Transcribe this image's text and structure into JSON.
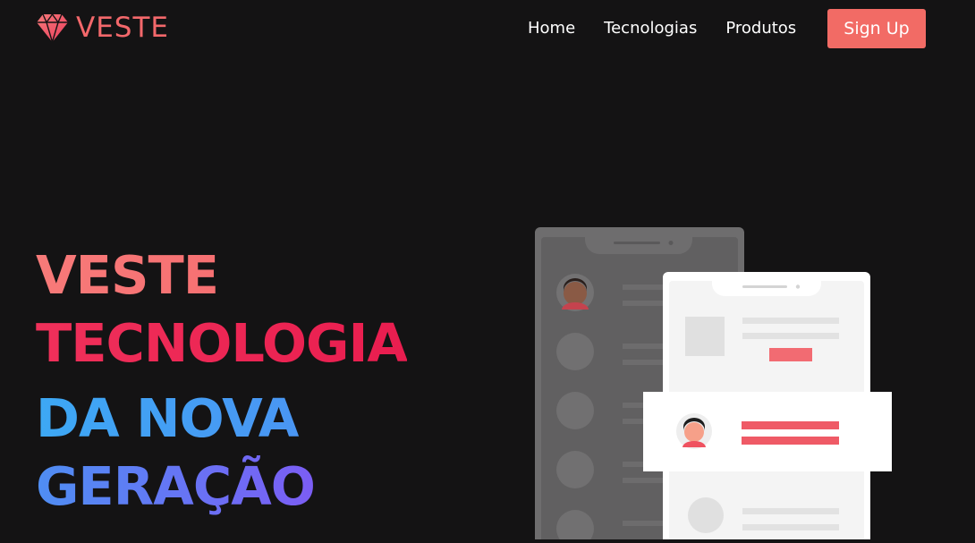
{
  "brand": {
    "name": "VESTE",
    "logo_icon": "diamond-icon",
    "accent_color": "#f26b65"
  },
  "nav": {
    "links": [
      {
        "label": "Home"
      },
      {
        "label": "Tecnologias"
      },
      {
        "label": "Produtos"
      }
    ],
    "signup_label": "Sign Up"
  },
  "hero": {
    "lines": [
      "VESTE",
      "TECNOLOGIA",
      "DA NOVA",
      "GERAÇÃO"
    ]
  },
  "illustration": {
    "name": "phones-chat-illustration"
  }
}
